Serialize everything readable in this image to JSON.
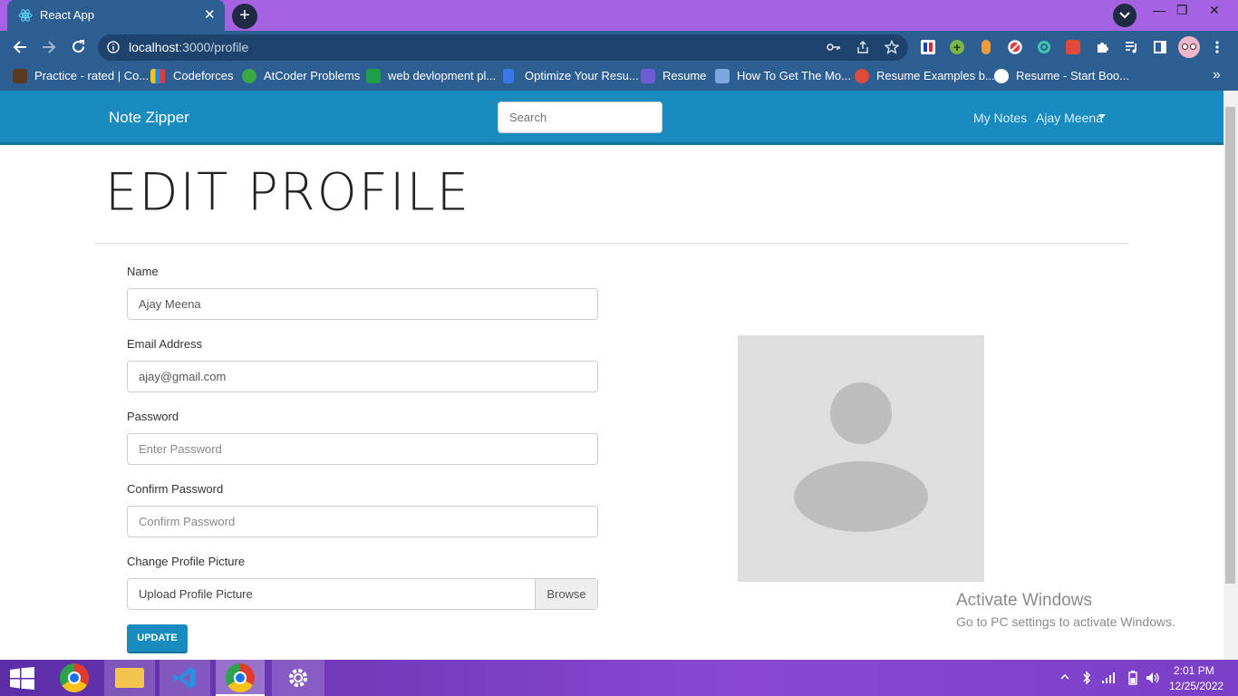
{
  "browser": {
    "tab_title": "React App",
    "tab_close": "✕",
    "new_tab": "+",
    "url_host": "localhost",
    "url_path": ":3000/profile",
    "window_min": "—",
    "window_max": "❐",
    "window_close": "✕",
    "bookmarks": [
      {
        "label": "Practice - rated | Co...",
        "icon": "codechef-icon",
        "color": "#6b3e1f"
      },
      {
        "label": "Codeforces",
        "icon": "codeforces-icon",
        "color": "#f5c518"
      },
      {
        "label": "AtCoder Problems",
        "icon": "atcoder-icon",
        "color": "#39a845"
      },
      {
        "label": "web devlopment pl...",
        "icon": "sheets-icon",
        "color": "#1e9e4a"
      },
      {
        "label": "Optimize Your Resu...",
        "icon": "resume-icon",
        "color": "#3b78e7"
      },
      {
        "label": "Resume",
        "icon": "code-icon",
        "color": "#6c5dd3"
      },
      {
        "label": "How To Get The Mo...",
        "icon": "layers-icon",
        "color": "#7aa7e0"
      },
      {
        "label": "Resume Examples b...",
        "icon": "resume-examples-icon",
        "color": "#e04a3a"
      },
      {
        "label": "Resume - Start Boo...",
        "icon": "globe-icon",
        "color": "#ffffff"
      }
    ],
    "bookmarks_more": "»"
  },
  "navbar": {
    "brand": "Note Zipper",
    "search_placeholder": "Search",
    "my_notes": "My Notes",
    "user_name": "Ajay Meena"
  },
  "profile": {
    "title": "EDIT PROFILE",
    "name_label": "Name",
    "name_value": "Ajay Meena",
    "email_label": "Email Address",
    "email_value": "ajay@gmail.com",
    "password_label": "Password",
    "password_placeholder": "Enter Password",
    "confirm_label": "Confirm Password",
    "confirm_placeholder": "Confirm Password",
    "picture_label": "Change Profile Picture",
    "picture_field": "Upload Profile Picture",
    "browse": "Browse",
    "update": "UPDATE"
  },
  "watermark": {
    "line1": "Activate Windows",
    "line2": "Go to PC settings to activate Windows."
  },
  "taskbar": {
    "time": "2:01 PM",
    "date": "12/25/2022"
  },
  "colors": {
    "navbar": "#1a8bbf",
    "tabbar": "#a463e0",
    "toolbar": "#2d5f93"
  }
}
